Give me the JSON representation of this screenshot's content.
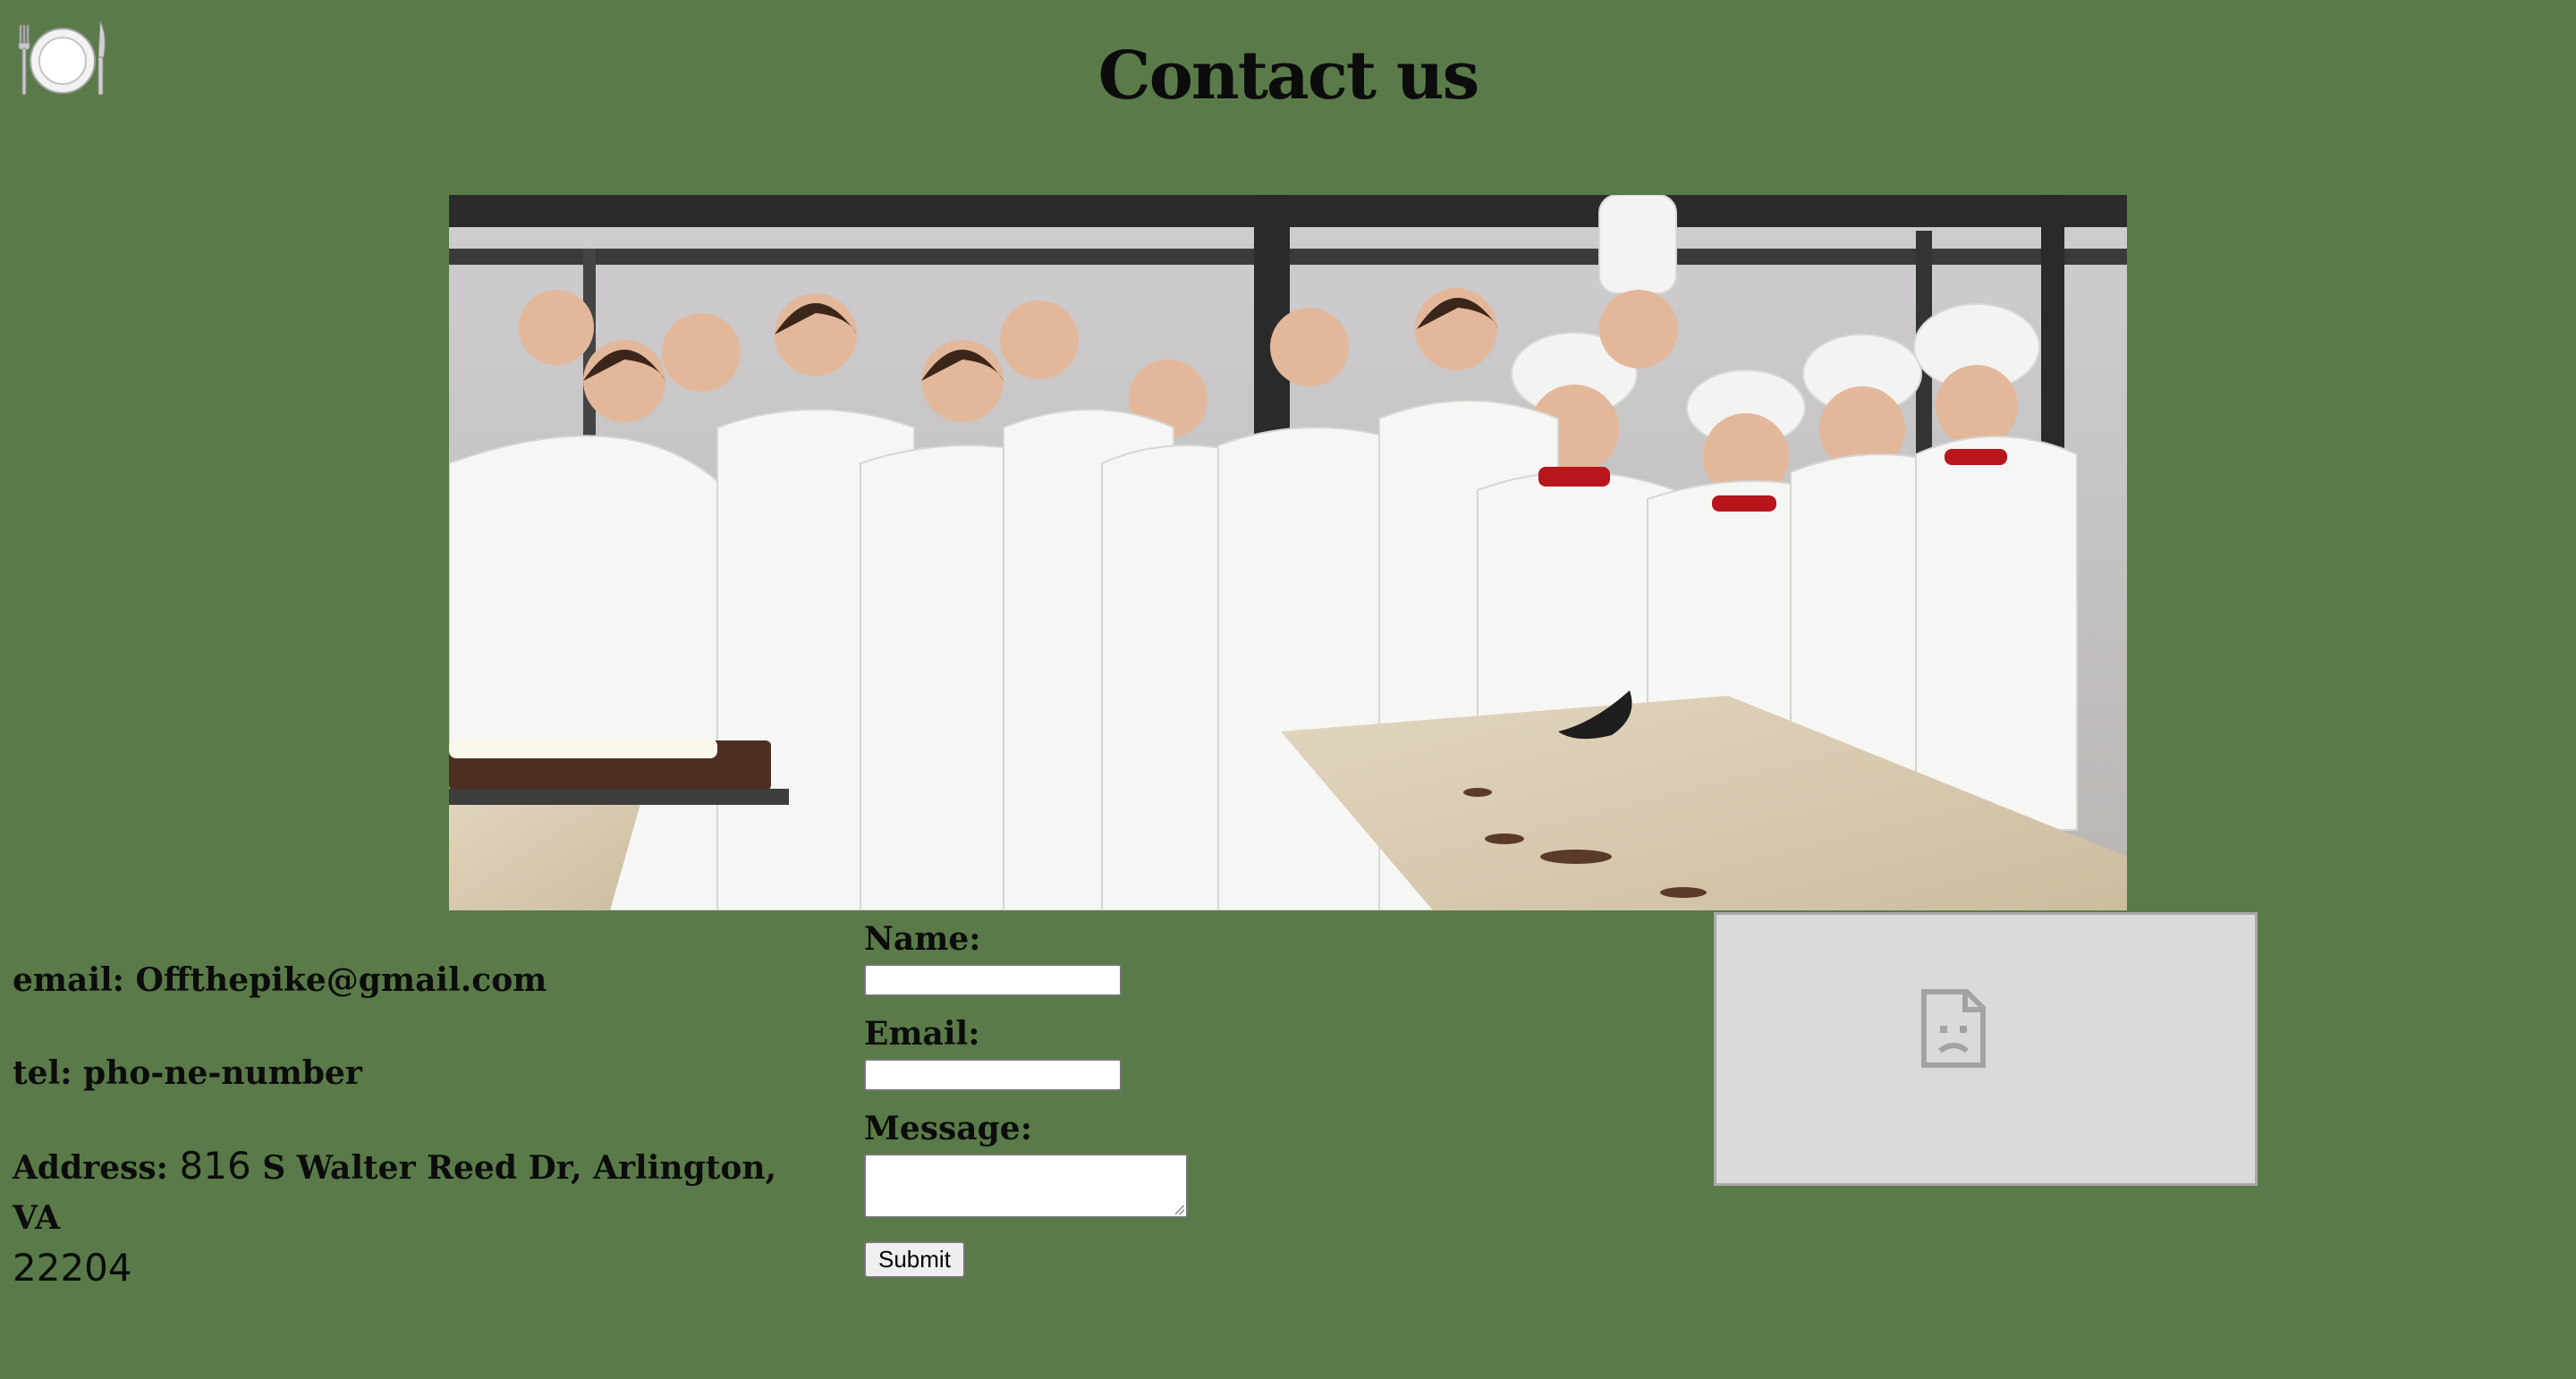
{
  "header": {
    "title": "Contact us",
    "logo_icon": "plate-fork-knife-icon"
  },
  "hero": {
    "image_icon": "kitchen-team-photo"
  },
  "contact": {
    "email": "email: Offthepike@gmail.com",
    "tel": "tel: pho-ne-number",
    "address_prefix": "Address: ",
    "address_number": "816",
    "address_street": " S Walter Reed Dr, Arlington, VA",
    "address_zip": "22204"
  },
  "form": {
    "name_label": "Name:",
    "email_label": "Email:",
    "message_label": "Message:",
    "submit_label": "Submit"
  },
  "map": {
    "icon": "broken-document-icon"
  },
  "colors": {
    "background": "#5a7b49",
    "text": "#0c0c0c",
    "placeholder": "#dadada"
  }
}
